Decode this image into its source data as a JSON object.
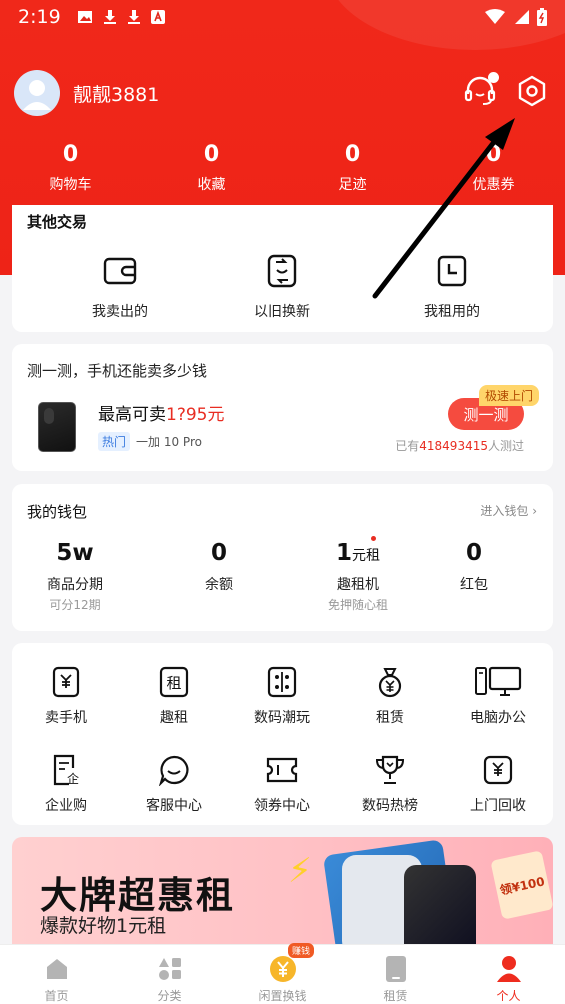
{
  "status_bar": {
    "time": "2:19"
  },
  "profile": {
    "username": "靓靓3881"
  },
  "stats": [
    {
      "value": "0",
      "label": "购物车"
    },
    {
      "value": "0",
      "label": "收藏"
    },
    {
      "value": "0",
      "label": "足迹"
    },
    {
      "value": "0",
      "label": "优惠券"
    }
  ],
  "other_trade": {
    "title": "其他交易",
    "items": [
      {
        "label": "我卖出的",
        "icon": "wallet-icon"
      },
      {
        "label": "以旧换新",
        "icon": "phone-swap-icon"
      },
      {
        "label": "我租用的",
        "icon": "clock-icon"
      }
    ]
  },
  "test": {
    "question": "测一测，手机还能卖多少钱",
    "price_prefix": "最高可卖",
    "price": "1?95元",
    "tag": "热门",
    "model": "一加 10 Pro",
    "button": "测一测",
    "badge": "极速上门",
    "tested_prefix": "已有",
    "tested_count": "418493415",
    "tested_suffix": "人测过"
  },
  "wallet": {
    "title": "我的钱包",
    "enter": "进入钱包",
    "items": [
      {
        "value": "5w",
        "unit": "",
        "label": "商品分期",
        "sub": "可分12期"
      },
      {
        "value": "0",
        "unit": "",
        "label": "余额",
        "sub": ""
      },
      {
        "value": "1",
        "unit": "元租",
        "label": "趣租机",
        "sub": "免押随心租"
      },
      {
        "value": "0",
        "unit": "",
        "label": "红包",
        "sub": ""
      }
    ]
  },
  "services": [
    {
      "label": "卖手机",
      "icon": "yuan-phone-icon"
    },
    {
      "label": "趣租",
      "icon": "rent-icon"
    },
    {
      "label": "数码潮玩",
      "icon": "gamepad-icon"
    },
    {
      "label": "租赁",
      "icon": "money-bag-icon"
    },
    {
      "label": "电脑办公",
      "icon": "computer-icon"
    },
    {
      "label": "企业购",
      "icon": "enterprise-icon"
    },
    {
      "label": "客服中心",
      "icon": "chat-icon"
    },
    {
      "label": "领券中心",
      "icon": "ticket-icon"
    },
    {
      "label": "数码热榜",
      "icon": "trophy-icon"
    },
    {
      "label": "上门回收",
      "icon": "recycle-yuan-icon"
    }
  ],
  "banner": {
    "title": "大牌超惠租",
    "subtitle": "爆款好物1元租",
    "coupon": "领¥100"
  },
  "tabbar": [
    {
      "label": "首页",
      "icon": "home-icon",
      "active": false
    },
    {
      "label": "分类",
      "icon": "category-icon",
      "active": false
    },
    {
      "label": "闲置换钱",
      "icon": "yuan-coin-icon",
      "active": false,
      "badge": "赚钱"
    },
    {
      "label": "租赁",
      "icon": "rent-phone-icon",
      "active": false
    },
    {
      "label": "个人",
      "icon": "person-icon",
      "active": true
    }
  ],
  "colors": {
    "primary_red": "#ee2317",
    "accent_red": "#e82d22"
  }
}
